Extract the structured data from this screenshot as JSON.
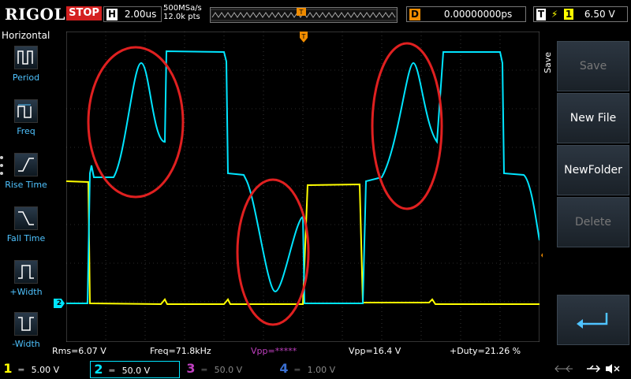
{
  "header": {
    "brand": "RIGOL",
    "run_state": "STOP",
    "horizontal": {
      "label": "H",
      "timebase": "2.00us"
    },
    "sample_rate": "500MSa/s",
    "points": "12.0k pts",
    "trigger_marker": "T",
    "delay": {
      "label": "D",
      "value": "0.00000000ps"
    },
    "trigger": {
      "label": "T",
      "edge_symbol": "⚡",
      "channel": "1",
      "level": "6.50 V"
    }
  },
  "left_menu": {
    "title": "Horizontal",
    "items": [
      {
        "label": "Period",
        "icon": "period-icon"
      },
      {
        "label": "Freq",
        "icon": "frequency-icon"
      },
      {
        "label": "Rise Time",
        "icon": "rise-time-icon"
      },
      {
        "label": "Fall Time",
        "icon": "fall-time-icon"
      },
      {
        "label": "+Width",
        "icon": "positive-width-icon"
      },
      {
        "label": "-Width",
        "icon": "negative-width-icon"
      }
    ]
  },
  "right_menu": {
    "title": "Save",
    "buttons": [
      {
        "label": "Save",
        "enabled": false
      },
      {
        "label": "New File",
        "enabled": true
      },
      {
        "label": "NewFolder",
        "enabled": true
      },
      {
        "label": "Delete",
        "enabled": false
      },
      {
        "label": "",
        "icon": "enter-arrow-icon",
        "enabled": true
      }
    ]
  },
  "measurements": [
    {
      "text": "Rms=6.07 V",
      "color": "#ffffff"
    },
    {
      "text": "Freq=71.8kHz",
      "color": "#ffffff"
    },
    {
      "text": "Vpp=*****",
      "color": "#c040c0"
    },
    {
      "text": "Vpp=16.4 V",
      "color": "#ffffff"
    },
    {
      "text": "+Duty=21.26 %",
      "color": "#ffffff"
    }
  ],
  "channels": [
    {
      "num": "1",
      "scale": "5.00 V",
      "color": "#ffff00",
      "active": false
    },
    {
      "num": "2",
      "scale": "50.0 V",
      "color": "#00e5ff",
      "active": true
    },
    {
      "num": "3",
      "scale": "50.0 V",
      "color": "#c040c0",
      "active": false
    },
    {
      "num": "4",
      "scale": "1.00 V",
      "color": "#3a6fd0",
      "active": false
    }
  ],
  "trace_markers": {
    "ch2_ground": "2",
    "trigger_level": "T"
  },
  "colors": {
    "ch1": "#ffff00",
    "ch2": "#00e5ff",
    "annotation": "#e02020",
    "accent": "#f08c00"
  }
}
